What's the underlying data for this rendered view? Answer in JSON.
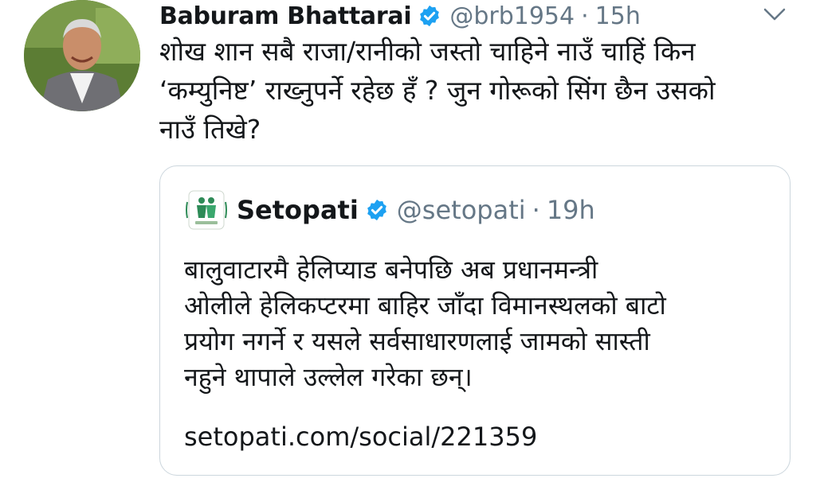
{
  "tweet": {
    "author_name": "Baburam Bhattarai",
    "handle": "@brb1954",
    "separator": "·",
    "time": "15h",
    "text": "शोख शान सबै राजा/रानीको जस्तो चाहिने नाउँ चाहिं किन\n‘कम्युनिष्ट’ राख्नुपर्ने रहेछ हँ ? जुन गोरूको सिंग छैन उसको\nनाउँ तिखे?",
    "icons": {
      "verified": "verified-badge-icon",
      "menu": "chevron-down-icon"
    }
  },
  "quoted_tweet": {
    "author_name": "Setopati",
    "handle": "@setopati",
    "separator": "·",
    "time": "19h",
    "text": "बालुवाटारमै हेलिप्याड बनेपछि अब प्रधानमन्त्री\nओलीले हेलिकप्टरमा बाहिर जाँदा विमानस्थलको बाटो\nप्रयोग नगर्ने र यसले सर्वसाधारणलाई जामको सास्ती\nनहुने थापाले उल्लेल गरेका छन्।",
    "link": "setopati.com/social/221359",
    "icons": {
      "logo": "setopati-logo-icon",
      "verified": "verified-badge-icon"
    }
  },
  "colors": {
    "text": "#14171a",
    "secondary": "#657786",
    "verified_blue": "#1da1f2",
    "border": "#ccd6dd"
  }
}
